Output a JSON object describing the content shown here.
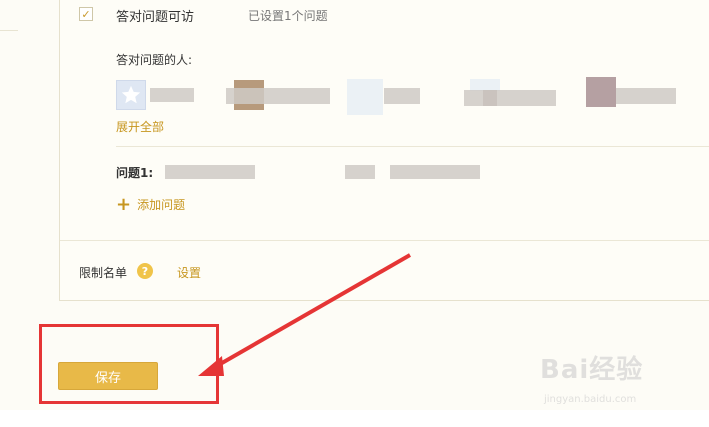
{
  "question_access": {
    "title": "答对问题可访",
    "status": "已设置1个问题",
    "checked_mark": "✓"
  },
  "answerers": {
    "label": "答对问题的人:",
    "expand_label": "展开全部"
  },
  "question": {
    "label": "问题1:",
    "add_label": "添加问题"
  },
  "restriction": {
    "label": "限制名单",
    "help_glyph": "?",
    "set_label": "设置"
  },
  "actions": {
    "save_label": "保存"
  },
  "watermark": {
    "brand": "Bai经验",
    "url": "jingyan.baidu.com"
  },
  "colors": {
    "accent": "#c7961f",
    "button": "#e8b948",
    "annotation": "#e53535"
  }
}
